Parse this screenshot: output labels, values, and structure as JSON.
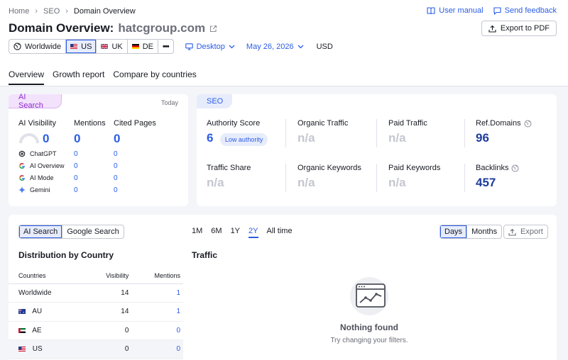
{
  "breadcrumb": {
    "home": "Home",
    "seo": "SEO",
    "current": "Domain Overview"
  },
  "header_links": {
    "manual": "User manual",
    "feedback": "Send feedback"
  },
  "title": {
    "prefix": "Domain Overview:",
    "domain": "hatcgroup.com"
  },
  "export_pdf": "Export to PDF",
  "locations": [
    {
      "label": "Worldwide",
      "selected": false
    },
    {
      "label": "US",
      "selected": true
    },
    {
      "label": "UK",
      "selected": false
    },
    {
      "label": "DE",
      "selected": false
    }
  ],
  "more": "•••",
  "device": "Desktop",
  "date": "May 26, 2026",
  "currency": "USD",
  "tabs": [
    "Overview",
    "Growth report",
    "Compare by countries"
  ],
  "ai_card": {
    "pill": "AI Search",
    "today": "Today",
    "visibility_label": "AI Visibility",
    "visibility_value": "0",
    "mentions_label": "Mentions",
    "mentions_value": "0",
    "cited_label": "Cited Pages",
    "cited_value": "0",
    "sources": [
      {
        "name": "ChatGPT",
        "icon": "chatgpt-icon",
        "mentions": "0",
        "cited": "0"
      },
      {
        "name": "AI Overview",
        "icon": "google-icon",
        "mentions": "0",
        "cited": "0"
      },
      {
        "name": "AI Mode",
        "icon": "google-icon",
        "mentions": "0",
        "cited": "0"
      },
      {
        "name": "Gemini",
        "icon": "gemini-icon",
        "mentions": "0",
        "cited": "0"
      }
    ]
  },
  "seo_card": {
    "pill": "SEO",
    "authority_label": "Authority Score",
    "authority_value": "6",
    "authority_badge": "Low authority",
    "organic_traffic_label": "Organic Traffic",
    "organic_traffic_value": "n/a",
    "paid_traffic_label": "Paid Traffic",
    "paid_traffic_value": "n/a",
    "ref_domains_label": "Ref.Domains",
    "ref_domains_value": "96",
    "traffic_share_label": "Traffic Share",
    "traffic_share_value": "n/a",
    "organic_kw_label": "Organic Keywords",
    "organic_kw_value": "n/a",
    "paid_kw_label": "Paid Keywords",
    "paid_kw_value": "n/a",
    "backlinks_label": "Backlinks",
    "backlinks_value": "457"
  },
  "bottom": {
    "search_toggle": [
      "AI Search",
      "Google Search"
    ],
    "periods": [
      "1M",
      "6M",
      "1Y",
      "2Y",
      "All time"
    ],
    "selected_period": "2Y",
    "granularity": [
      "Days",
      "Months"
    ],
    "export": "Export",
    "distribution_title": "Distribution by Country",
    "traffic_title": "Traffic",
    "table_headers": [
      "Countries",
      "Visibility",
      "Mentions"
    ],
    "rows": [
      {
        "country": "Worldwide",
        "flag": "",
        "visibility": "14",
        "mentions": "1"
      },
      {
        "country": "AU",
        "flag": "au",
        "visibility": "14",
        "mentions": "1"
      },
      {
        "country": "AE",
        "flag": "ae",
        "visibility": "0",
        "mentions": "0"
      },
      {
        "country": "US",
        "flag": "us",
        "visibility": "0",
        "mentions": "0"
      }
    ],
    "empty_title": "Nothing found",
    "empty_sub": "Try changing your filters."
  }
}
